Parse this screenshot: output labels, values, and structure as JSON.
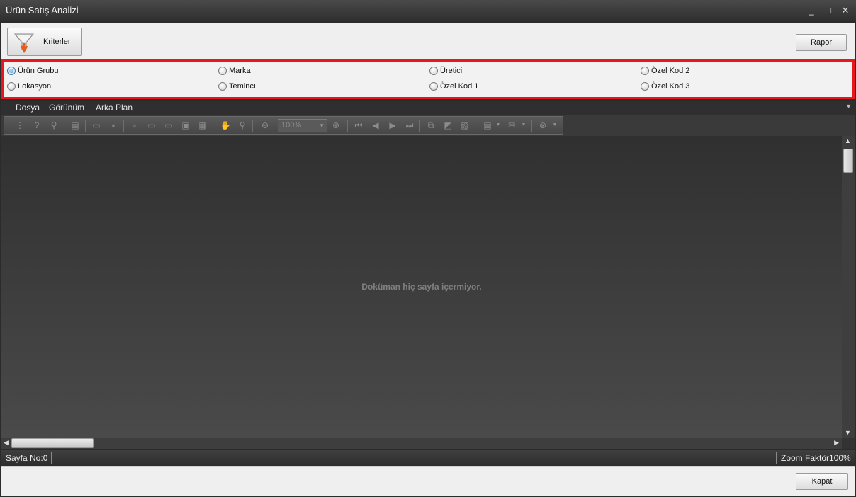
{
  "window": {
    "title": "Ürün Satış Analizi",
    "controls": {
      "minimize": "_",
      "maximize": "□",
      "close": "✕"
    }
  },
  "top_panel": {
    "criteria_button": {
      "label": "Kriterler",
      "icon": "funnel-icon"
    },
    "report_button": {
      "label": "Rapor"
    }
  },
  "grouping": {
    "selected": "Ürün Grubu",
    "options": [
      {
        "label": "Ürün Grubu",
        "selected": true
      },
      {
        "label": "Marka",
        "selected": false
      },
      {
        "label": "Üretici",
        "selected": false
      },
      {
        "label": "Özel Kod 2",
        "selected": false
      },
      {
        "label": "Lokasyon",
        "selected": false
      },
      {
        "label": "Temincı",
        "selected": false
      },
      {
        "label": "Özel Kod 1",
        "selected": false
      },
      {
        "label": "Özel Kod 3",
        "selected": false
      }
    ],
    "border_color": "#e8171e"
  },
  "viewer": {
    "menu": [
      "Dosya",
      "Görünüm",
      "Arka Plan"
    ],
    "zoom_value": "100%",
    "empty_message": "Doküman hiç sayfa içermiyor.",
    "toolbar_icons": [
      "document-map-icon",
      "help-icon",
      "search-icon",
      "customize-icon",
      "open-icon",
      "save-icon",
      "page-setup-icon",
      "print-icon",
      "quick-print-icon",
      "header-footer-icon",
      "scale-icon",
      "hand-tool-icon",
      "magnifier-icon",
      "zoom-out-icon",
      "zoom-in-icon",
      "first-page-icon",
      "previous-page-icon",
      "next-page-icon",
      "last-page-icon",
      "multiple-pages-icon",
      "fill-background-icon",
      "watermark-icon",
      "export-icon",
      "send-email-icon",
      "close-preview-icon"
    ]
  },
  "status": {
    "page_label": "Sayfa No:0",
    "zoom_label": "Zoom Faktör100%"
  },
  "bottom_panel": {
    "close_button": {
      "label": "Kapat"
    }
  }
}
